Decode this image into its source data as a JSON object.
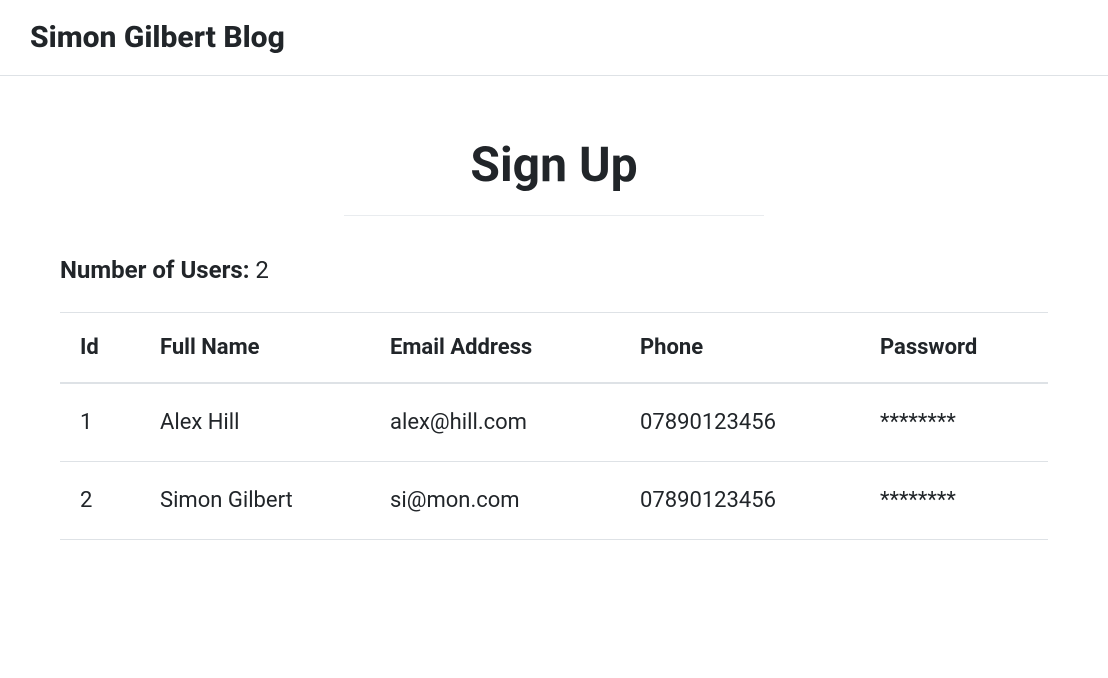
{
  "header": {
    "title": "Simon Gilbert Blog"
  },
  "page": {
    "title": "Sign Up",
    "user_count_label": "Number of Users:",
    "user_count_value": "2"
  },
  "table": {
    "columns": {
      "id": "Id",
      "full_name": "Full Name",
      "email": "Email Address",
      "phone": "Phone",
      "password": "Password"
    },
    "rows": [
      {
        "id": "1",
        "full_name": "Alex Hill",
        "email": "alex@hill.com",
        "phone": "07890123456",
        "password": "********"
      },
      {
        "id": "2",
        "full_name": "Simon Gilbert",
        "email": "si@mon.com",
        "phone": "07890123456",
        "password": "********"
      }
    ]
  }
}
